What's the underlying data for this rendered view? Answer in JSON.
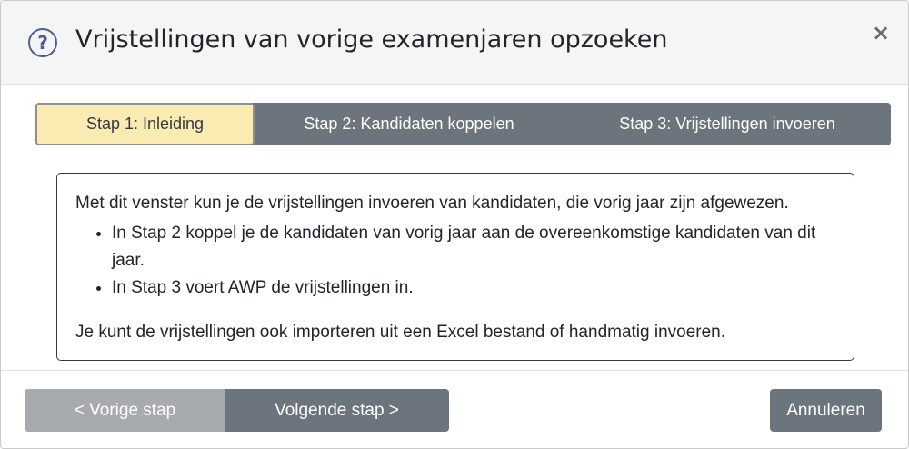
{
  "dialog": {
    "title": "Vrijstellingen van vorige examenjaren opzoeken",
    "help_icon": "question-circle-icon",
    "close_label": "×"
  },
  "steps": [
    {
      "label": "Stap 1: Inleiding",
      "active": true
    },
    {
      "label": "Stap 2: Kandidaten koppelen",
      "active": false
    },
    {
      "label": "Stap 3: Vrijstellingen invoeren",
      "active": false
    }
  ],
  "info": {
    "intro": "Met dit venster kun je de vrijstellingen invoeren van kandidaten, die vorig jaar zijn afgewezen.",
    "bullets": [
      "In Stap 2 koppel je de kandidaten van vorig jaar aan de overeenkomstige kandidaten van dit jaar.",
      "In Stap 3 voert AWP de vrijstellingen in."
    ],
    "outro": "Je kunt de vrijstellingen ook importeren uit een Excel bestand of handmatig invoeren."
  },
  "footer": {
    "prev_label": "< Vorige stap",
    "next_label": "Volgende stap >",
    "cancel_label": "Annuleren"
  },
  "colors": {
    "active_step": "#faebb3",
    "step_bar": "#6c757d",
    "button_disabled": "#a7abb0",
    "icon": "#4e5d9a"
  }
}
